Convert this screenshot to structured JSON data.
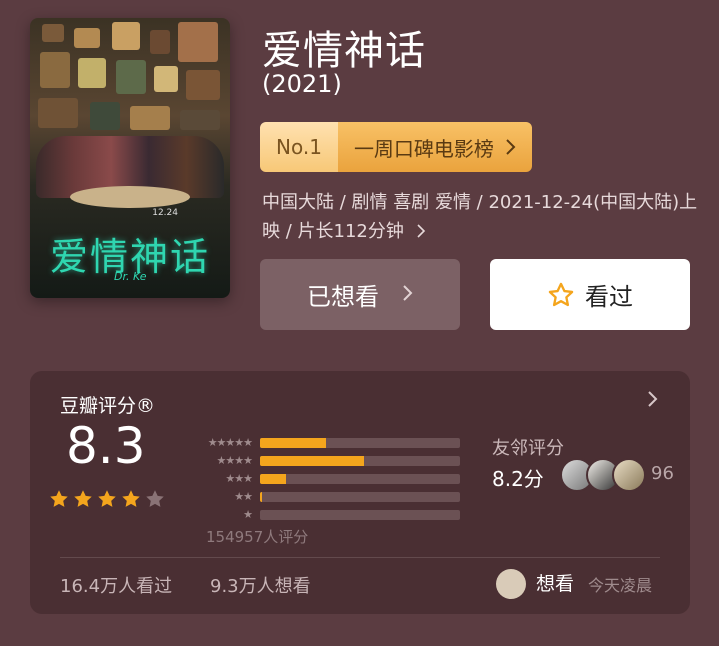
{
  "movie": {
    "title": "爱情神话",
    "year": "(2021)",
    "poster": {
      "title_art": "爱情神话",
      "date_art": "12.24",
      "sign_art": "Dr. Ke"
    },
    "rank": {
      "no": "No.1",
      "label": "一周口碑电影榜",
      "chevron": "chevron-right-icon"
    },
    "meta": {
      "line": "中国大陆 / 剧情 喜剧 爱情 / 2021-12-24(中国大陆)上映 / 片长112分钟",
      "chevron": "chevron-right-icon"
    },
    "actions": {
      "want_label": "已想看",
      "seen_label": "看过",
      "seen_icon": "star-outline-icon"
    }
  },
  "rating": {
    "label": "豆瓣评分®",
    "score": "8.3",
    "stars_filled": 4,
    "stars_total": 5,
    "distribution": [
      {
        "stars": "★★★★★",
        "fraction": 0.33
      },
      {
        "stars": "★★★★",
        "fraction": 0.52
      },
      {
        "stars": "★★★",
        "fraction": 0.13
      },
      {
        "stars": "★★",
        "fraction": 0.01
      },
      {
        "stars": "★",
        "fraction": 0.0
      }
    ],
    "count_text": "154957人评分",
    "friends": {
      "label": "友邻评分",
      "score": "8.2分",
      "count": "96"
    },
    "stats": {
      "seen": "16.4万人看过",
      "want": "9.3万人想看"
    },
    "user": {
      "status": "想看",
      "time": "今天凌晨"
    }
  },
  "colors": {
    "background": "#5b3c41",
    "card": "#4a2f33",
    "accent_orange": "#f4a51d",
    "teal_title": "#2fd6b0"
  }
}
